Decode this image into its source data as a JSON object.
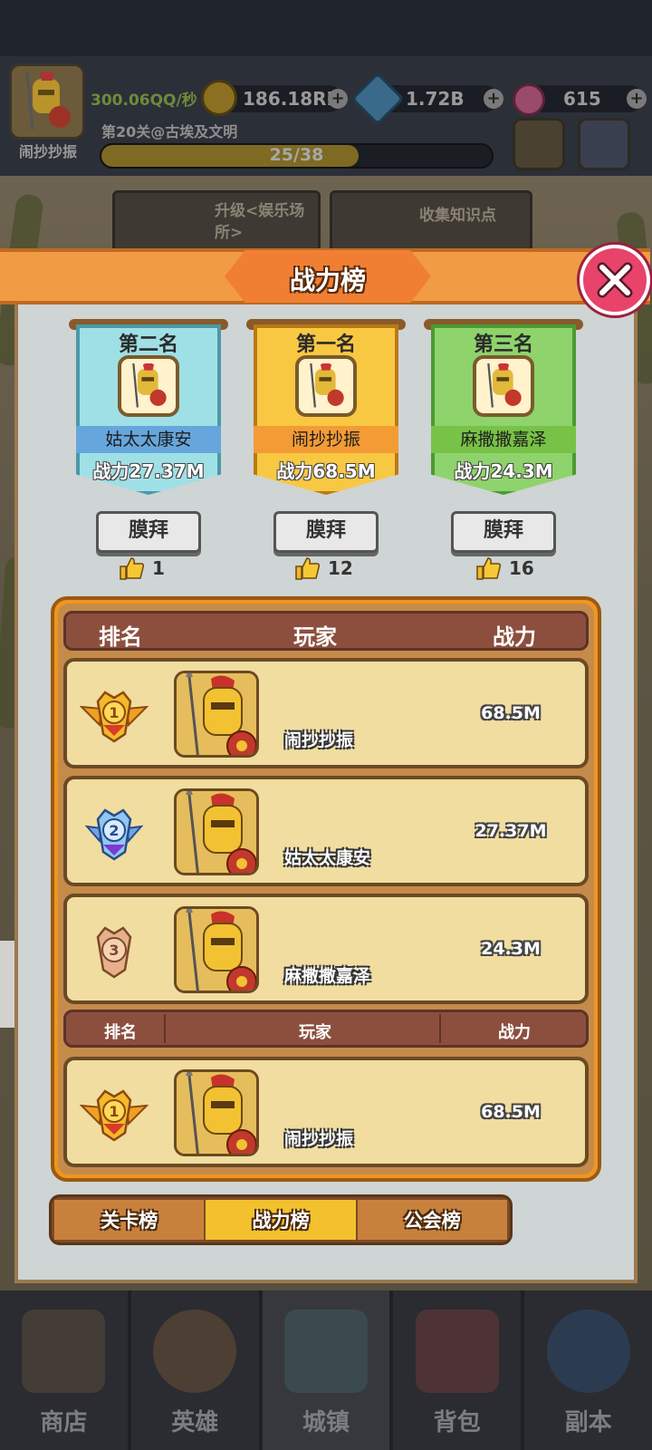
{
  "header": {
    "player_name": "闹抄抄振",
    "income": "300.06QQ/秒",
    "crowns": "186.18RR",
    "gems": "1.72B",
    "candy": "615",
    "stage": "第20关@古埃及文明",
    "progress_text": "25/38",
    "progress_fraction": 0.66
  },
  "quests": {
    "upgrade": "升级<娱乐场所>",
    "collect": "收集知识点"
  },
  "modal": {
    "title": "战力榜",
    "podium": [
      {
        "rank_title": "第二名",
        "name": "姑太太康安",
        "power": "战力27.37M",
        "worship_label": "膜拜",
        "likes": "1",
        "theme": "#9fe0e6",
        "namebar": "#66a6dc",
        "border": "#4a9aa8"
      },
      {
        "rank_title": "第一名",
        "name": "闹抄抄振",
        "power": "战力68.5M",
        "worship_label": "膜拜",
        "likes": "12",
        "theme": "#f9c843",
        "namebar": "#f39b35",
        "border": "#b97a15"
      },
      {
        "rank_title": "第三名",
        "name": "麻撒撒嘉泽",
        "power": "战力24.3M",
        "worship_label": "膜拜",
        "likes": "16",
        "theme": "#8fd36c",
        "namebar": "#78c247",
        "border": "#4b9a36"
      }
    ],
    "table_header": {
      "rank": "排名",
      "player": "玩家",
      "power": "战力"
    },
    "rows": [
      {
        "name": "闹抄抄振",
        "power": "68.5M",
        "medal": "gold"
      },
      {
        "name": "姑太太康安",
        "power": "27.37M",
        "medal": "silver"
      },
      {
        "name": "麻撒撒嘉泽",
        "power": "24.3M",
        "medal": "bronze"
      }
    ],
    "my_header": {
      "rank": "排名",
      "player": "玩家",
      "power": "战力"
    },
    "my_row": {
      "name": "闹抄抄振",
      "power": "68.5M",
      "medal": "gold"
    },
    "tabs": [
      "关卡榜",
      "战力榜",
      "公会榜"
    ],
    "active_tab": 1
  },
  "nav": [
    {
      "label": "商店",
      "icon": "shop-icon"
    },
    {
      "label": "英雄",
      "icon": "hero-icon"
    },
    {
      "label": "城镇",
      "icon": "town-icon"
    },
    {
      "label": "背包",
      "icon": "backpack-icon"
    },
    {
      "label": "副本",
      "icon": "globe-icon"
    }
  ],
  "colors": {
    "accent": "#f19b45",
    "close": "#e8436a",
    "row_bg": "#f1dda0"
  }
}
